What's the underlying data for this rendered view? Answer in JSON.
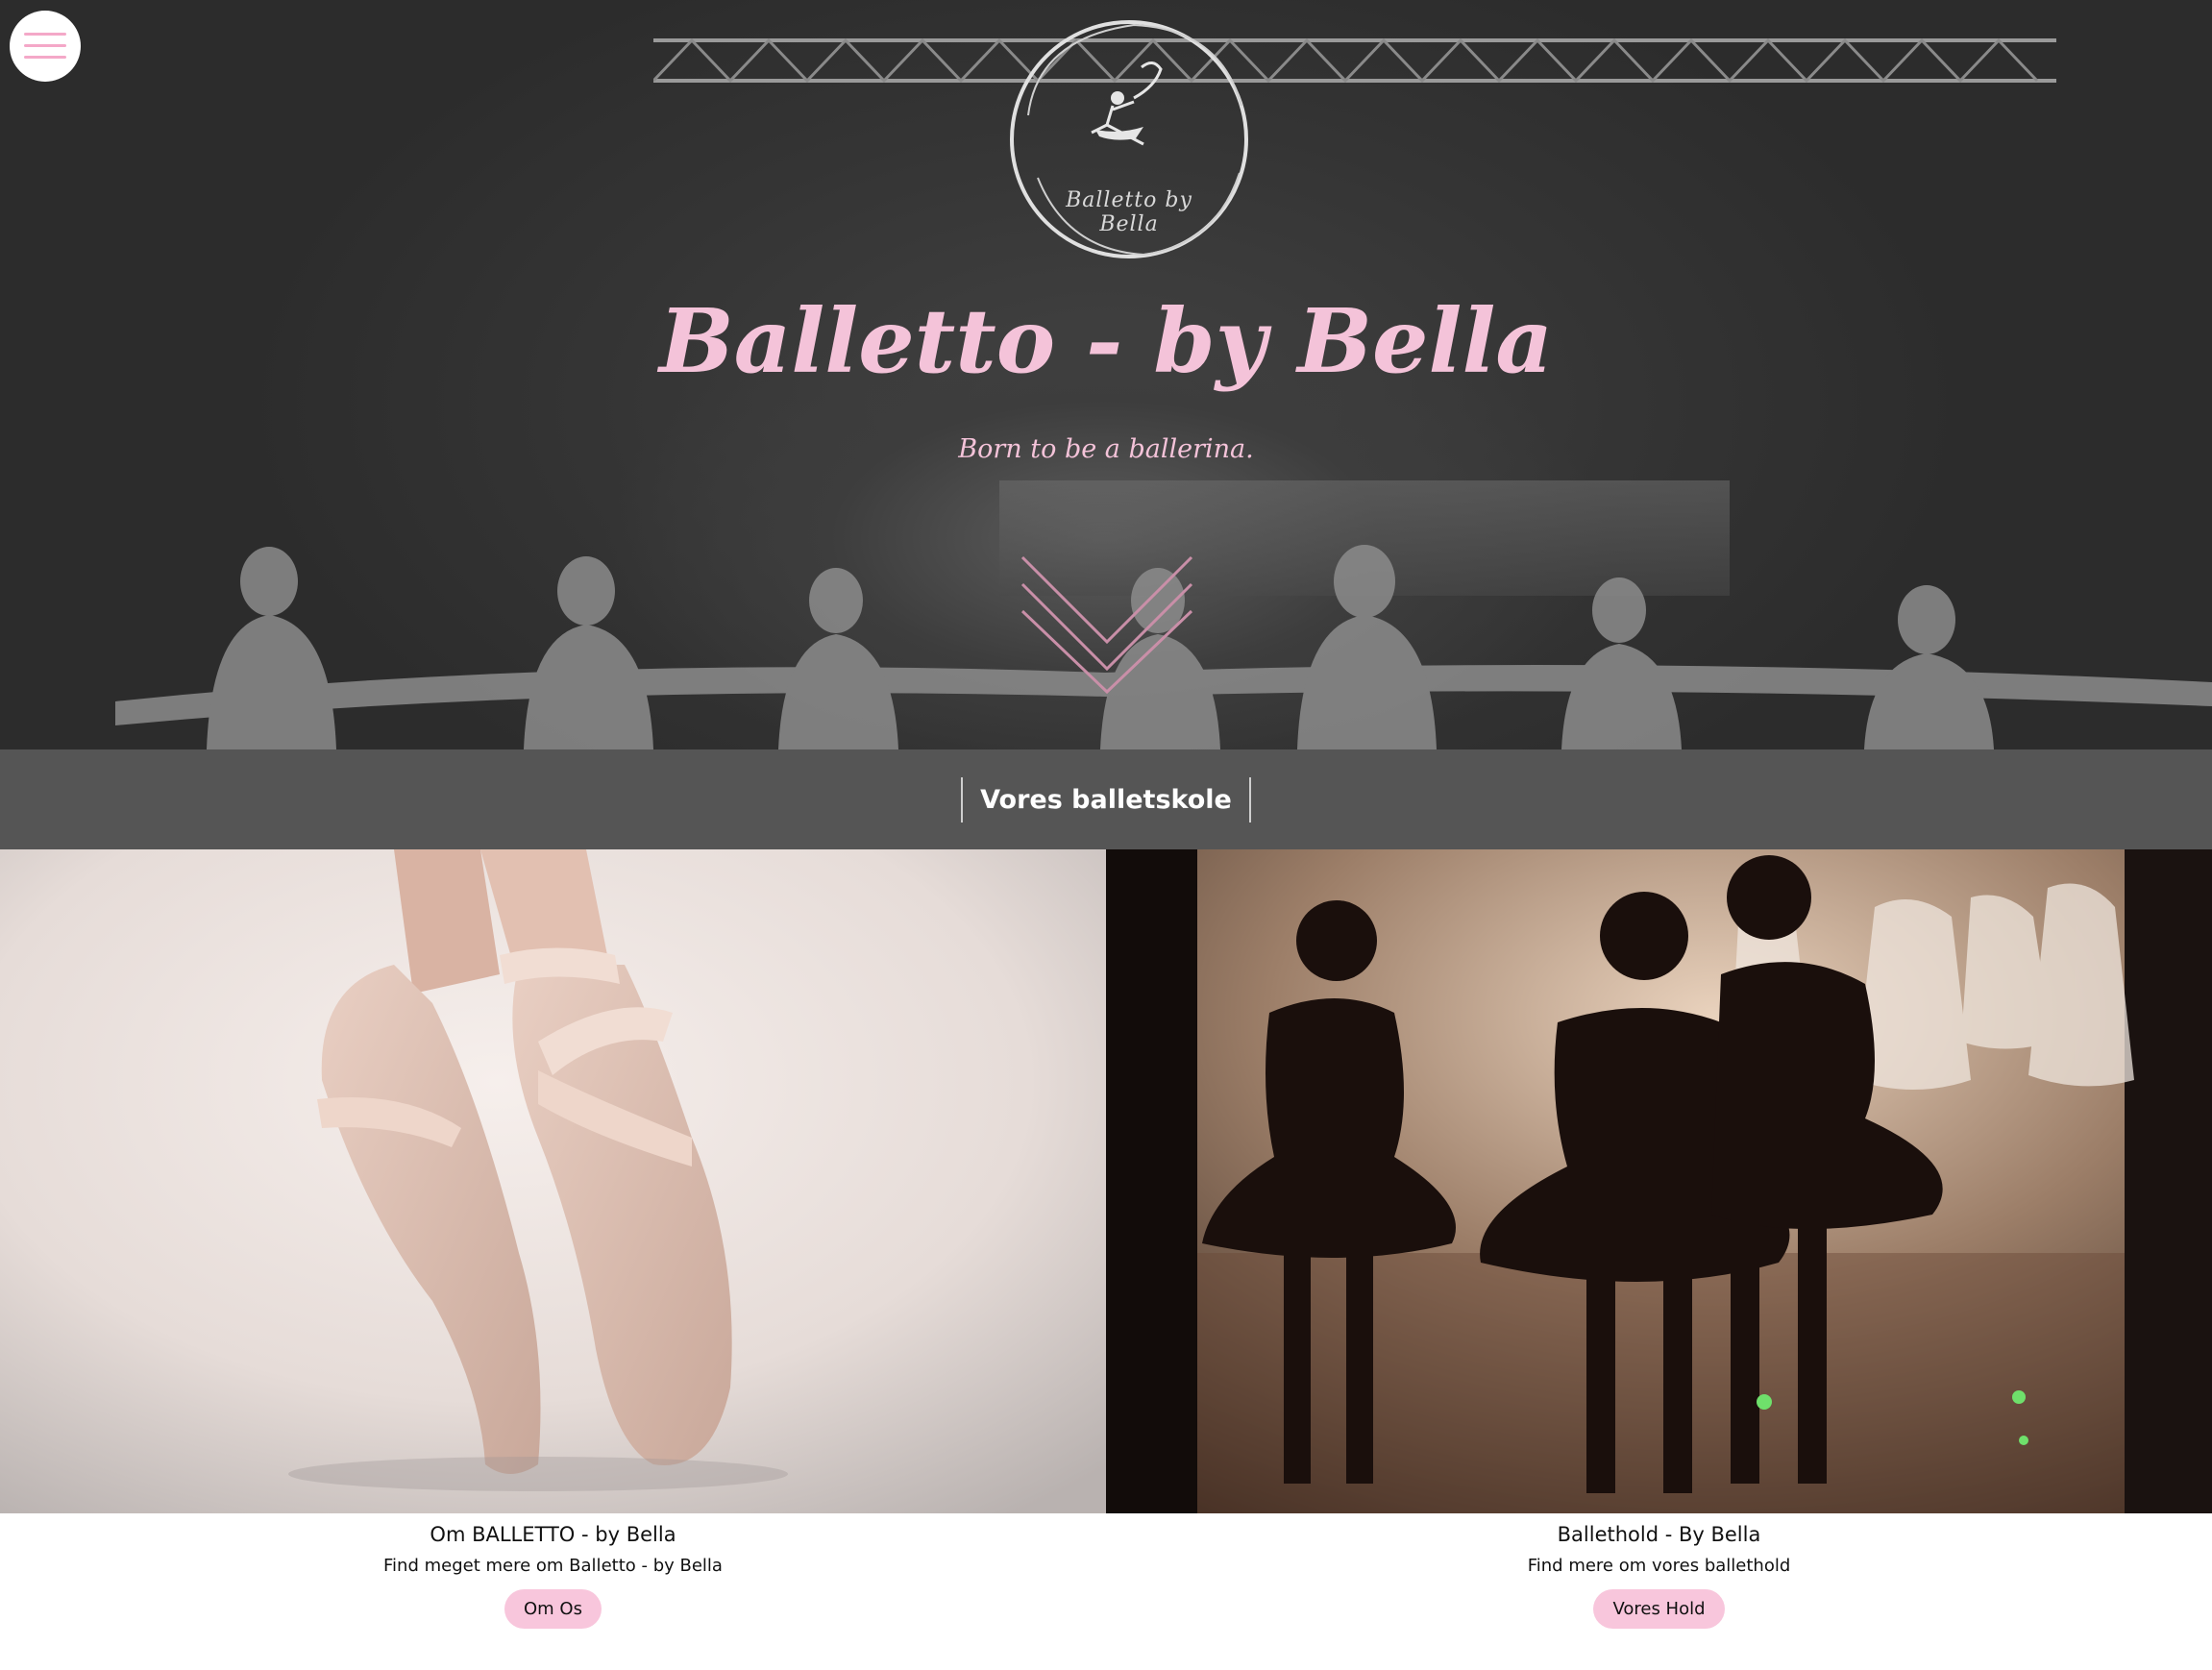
{
  "colors": {
    "accent_pink": "#f4c3d9",
    "button_pink": "#f8c6dc",
    "section_bar": "#555555",
    "hero_dark": "#333333"
  },
  "header": {
    "menu_icon": "hamburger-menu-icon",
    "logo_icon": "ballerina-circle-logo-icon",
    "logo_script": "Balletto by Bella"
  },
  "hero": {
    "title": "Balletto - by Bella",
    "subtitle": "Born to be a ballerina.",
    "scroll_icon": "chevron-down-icon"
  },
  "section": {
    "heading": "Vores balletskole"
  },
  "cards": [
    {
      "title": "Om BALLETTO - by Bella",
      "text": "Find meget mere om Balletto - by Bella",
      "button": "Om Os"
    },
    {
      "title": "Ballethold - By Bella",
      "text": "Find mere om vores ballethold",
      "button": "Vores Hold"
    }
  ]
}
